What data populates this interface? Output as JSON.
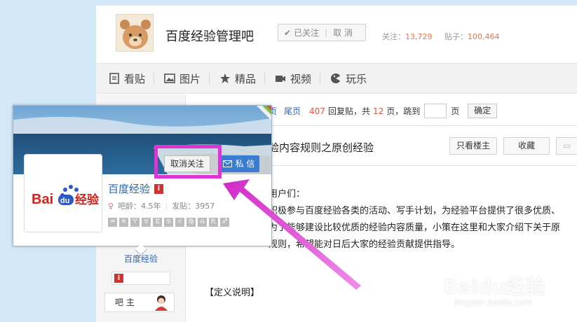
{
  "header": {
    "forum_name": "百度经验管理吧",
    "follow_state": "已关注",
    "unfollow": "取 消",
    "follow_label": "关注：",
    "follow_count": "13,729",
    "posts_label": "贴子：",
    "posts_count": "100,464"
  },
  "nav": {
    "items": [
      "看贴",
      "图片",
      "精品",
      "视频",
      "玩乐"
    ]
  },
  "pager": {
    "prev_tail": "页",
    "last": "尾页",
    "reply_count": "407",
    "reply_label": "回复贴，共",
    "page_count": "12",
    "page_unit": "页，跳到",
    "page_unit2": "页",
    "go": "确定"
  },
  "post": {
    "title": "验内容规则之原创经验",
    "only_owner": "只看楼主",
    "collect": "收藏",
    "lines": [
      "用户们：",
      "积极参与百度经验各类的活动、写手计划，为经验平台提供了很多优质、",
      "为了能够建设比较优质的经验内容质量，小策在这里和大家介绍下关于原",
      "规则，希望能对日后大家的经验贡献提供指导。"
    ],
    "definition": "【定义说明】"
  },
  "card": {
    "name": "百度经验",
    "level": "i",
    "age": "吧龄：4.5年",
    "posts": "发贴：3957",
    "unfollow": "取消关注",
    "pm": "私 信",
    "logo_text_en": "Bai",
    "logo_text_du": "du",
    "logo_text_cn": "经验",
    "zodiac": [
      "♒",
      "♓",
      "♈",
      "♉",
      "♊",
      "♋",
      "♌",
      "♍",
      "♎",
      "♏",
      "♐"
    ]
  },
  "sidebar": {
    "name": "百度经验",
    "level": "i",
    "role": "吧 主"
  },
  "watermark": {
    "main": "Baidu经验",
    "url": "jingyan.baidu.com"
  },
  "colors": {
    "accent_blue": "#2d64b3",
    "highlight": "#e033d5",
    "stat_orange": "#f0734a"
  }
}
